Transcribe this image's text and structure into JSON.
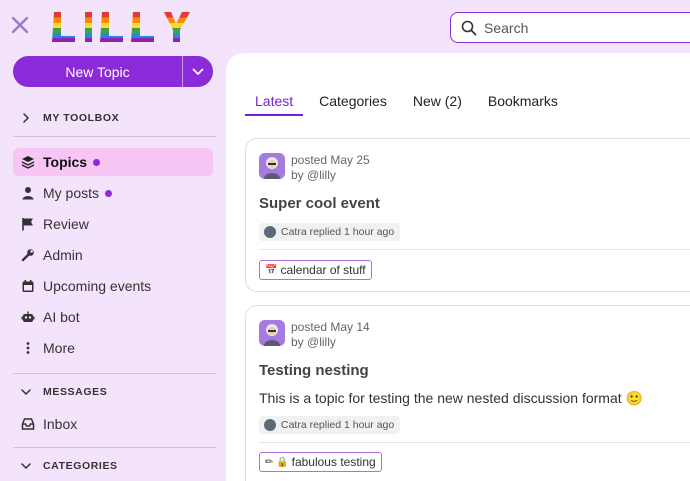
{
  "header": {
    "logo_text": "LILLY",
    "search_placeholder": "Search"
  },
  "new_topic": {
    "label": "New Topic"
  },
  "sidebar": {
    "toolbox_label": "MY TOOLBOX",
    "items": [
      {
        "label": "Topics",
        "icon": "layers-icon",
        "active": true,
        "dot": true
      },
      {
        "label": "My posts",
        "icon": "user-icon",
        "dot": true
      },
      {
        "label": "Review",
        "icon": "flag-icon"
      },
      {
        "label": "Admin",
        "icon": "wrench-icon"
      },
      {
        "label": "Upcoming events",
        "icon": "calendar-icon"
      },
      {
        "label": "AI bot",
        "icon": "robot-icon"
      },
      {
        "label": "More",
        "icon": "vertical-dots-icon"
      }
    ],
    "messages_label": "MESSAGES",
    "inbox_label": "Inbox",
    "categories_label": "CATEGORIES"
  },
  "tabs": [
    {
      "label": "Latest",
      "active": true
    },
    {
      "label": "Categories"
    },
    {
      "label": "New (2)"
    },
    {
      "label": "Bookmarks"
    }
  ],
  "topics": [
    {
      "posted": "posted May 25",
      "by": "by @lilly",
      "title": "Super cool event",
      "reply": "Catra replied 1 hour ago",
      "tag": "calendar of stuff",
      "tag_icon": "📅"
    },
    {
      "posted": "posted May 14",
      "by": "by @lilly",
      "title": "Testing nesting",
      "excerpt": "This is a topic for testing the new nested discussion format 🙂",
      "reply": "Catra replied 1 hour ago",
      "tag": "fabulous testing",
      "tag_icon": "✏ 🔒"
    }
  ],
  "colors": {
    "accent": "#8a2ad8",
    "sidebar_bg": "#f3e3fb",
    "active_bg": "#f7c6f5"
  }
}
